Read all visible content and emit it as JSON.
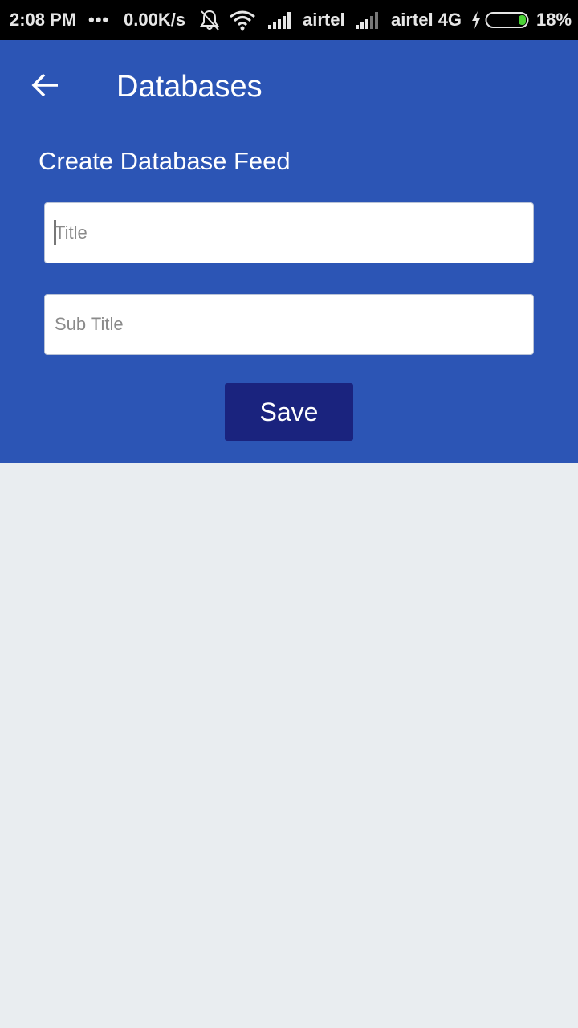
{
  "status_bar": {
    "time": "2:08 PM",
    "dots": "•••",
    "speed": "0.00K/s",
    "carrier1": "airtel",
    "carrier2": "airtel 4G",
    "battery": "18%",
    "icons": [
      "notifications-off-icon",
      "wifi-icon",
      "signal-icon",
      "signal-icon",
      "charging-icon",
      "battery-icon"
    ],
    "battery_level": 0.18,
    "battery_color": "#4cd137"
  },
  "app_bar": {
    "title": "Databases",
    "back_icon": "arrow-back-icon"
  },
  "form": {
    "heading": "Create Database Feed",
    "title_placeholder": "Title",
    "subtitle_placeholder": "Sub Title",
    "save_label": "Save"
  },
  "colors": {
    "primary": "#2c55b5",
    "button": "#1a237e",
    "background": "#e9edf0"
  }
}
